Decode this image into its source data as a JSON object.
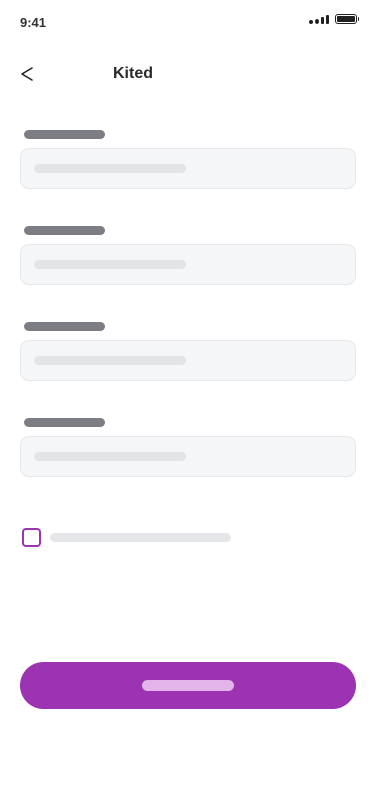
{
  "status_bar": {
    "time": "9:41"
  },
  "header": {
    "title": "Kited",
    "back_icon": "chevron-left-icon"
  },
  "form": {
    "fields_count_visible": 4,
    "field_style": "skeleton-placeholder"
  },
  "colors": {
    "accent": "#9b33b2",
    "skeleton_label": "#7d7e85",
    "skeleton_placeholder": "#e3e4e7",
    "input_background": "#f5f6f7",
    "button_text_skeleton": "#e3b4ea"
  },
  "icons": {
    "status_signal": "signal-icon",
    "status_battery": "battery-icon",
    "back": "chevron-left-icon"
  }
}
